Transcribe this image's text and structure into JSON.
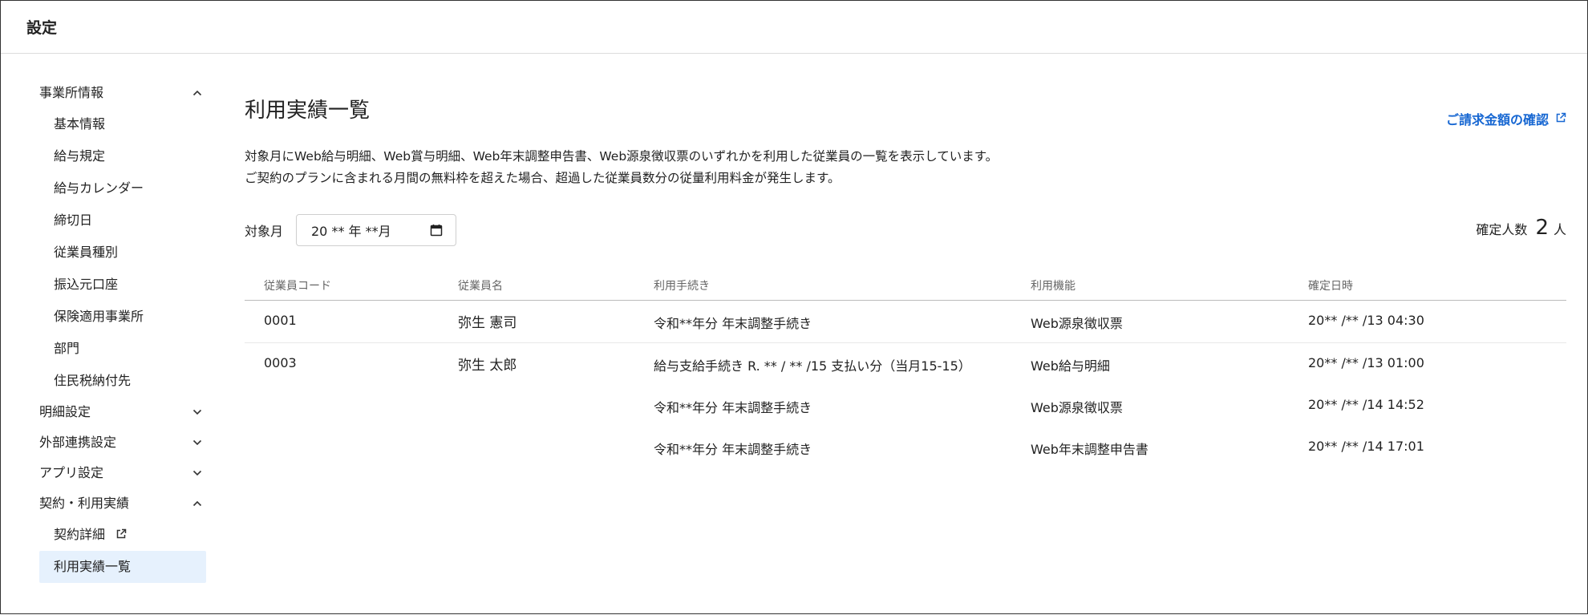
{
  "app": {
    "title": "設定"
  },
  "sidebar": {
    "groups": [
      {
        "label": "事業所情報",
        "expanded": true,
        "items": [
          {
            "label": "基本情報"
          },
          {
            "label": "給与規定"
          },
          {
            "label": "給与カレンダー"
          },
          {
            "label": "締切日"
          },
          {
            "label": "従業員種別"
          },
          {
            "label": "振込元口座"
          },
          {
            "label": "保険適用事業所"
          },
          {
            "label": "部門"
          },
          {
            "label": "住民税納付先"
          }
        ]
      },
      {
        "label": "明細設定",
        "expanded": false,
        "items": []
      },
      {
        "label": "外部連携設定",
        "expanded": false,
        "items": []
      },
      {
        "label": "アプリ設定",
        "expanded": false,
        "items": []
      },
      {
        "label": "契約・利用実績",
        "expanded": true,
        "items": [
          {
            "label": "契約詳細",
            "external": true
          },
          {
            "label": "利用実績一覧",
            "active": true
          }
        ]
      }
    ]
  },
  "main": {
    "title": "利用実績一覧",
    "billing_link": "ご請求金額の確認",
    "description": [
      "対象月にWeb給与明細、Web賞与明細、Web年末調整申告書、Web源泉徴収票のいずれかを利用した従業員の一覧を表示しています。",
      "ご契約のプランに含まれる月間の無料枠を超えた場合、超過した従業員数分の従量利用料金が発生します。"
    ],
    "target_month_label": "対象月",
    "target_month_value": "20 ** 年  **月",
    "confirmed_label": "確定人数",
    "confirmed_count": "2",
    "confirmed_unit": "人"
  },
  "table": {
    "headers": {
      "code": "従業員コード",
      "name": "従業員名",
      "procedure": "利用手続き",
      "function": "利用機能",
      "date": "確定日時"
    },
    "rows": [
      {
        "code": "0001",
        "name": "弥生 憲司",
        "entries": [
          {
            "procedure": "令和**年分 年末調整手続き",
            "function": "Web源泉徴収票",
            "date": "20** /** /13 04:30"
          }
        ]
      },
      {
        "code": "0003",
        "name": "弥生 太郎",
        "entries": [
          {
            "procedure": "給与支給手続き R. ** / ** /15 支払い分（当月15-15）",
            "function": "Web給与明細",
            "date": "20** /** /13 01:00"
          },
          {
            "procedure": "令和**年分 年末調整手続き",
            "function": "Web源泉徴収票",
            "date": "20** /** /14 14:52"
          },
          {
            "procedure": "令和**年分 年末調整手続き",
            "function": "Web年末調整申告書",
            "date": "20** /** /14 17:01"
          }
        ]
      }
    ]
  },
  "colors": {
    "accent": "#1767d2",
    "active_bg": "#e6f1fd"
  },
  "icons": {
    "expanded": "chevron-up-icon",
    "collapsed": "chevron-down-icon",
    "external": "external-link-icon",
    "calendar": "calendar-icon"
  }
}
